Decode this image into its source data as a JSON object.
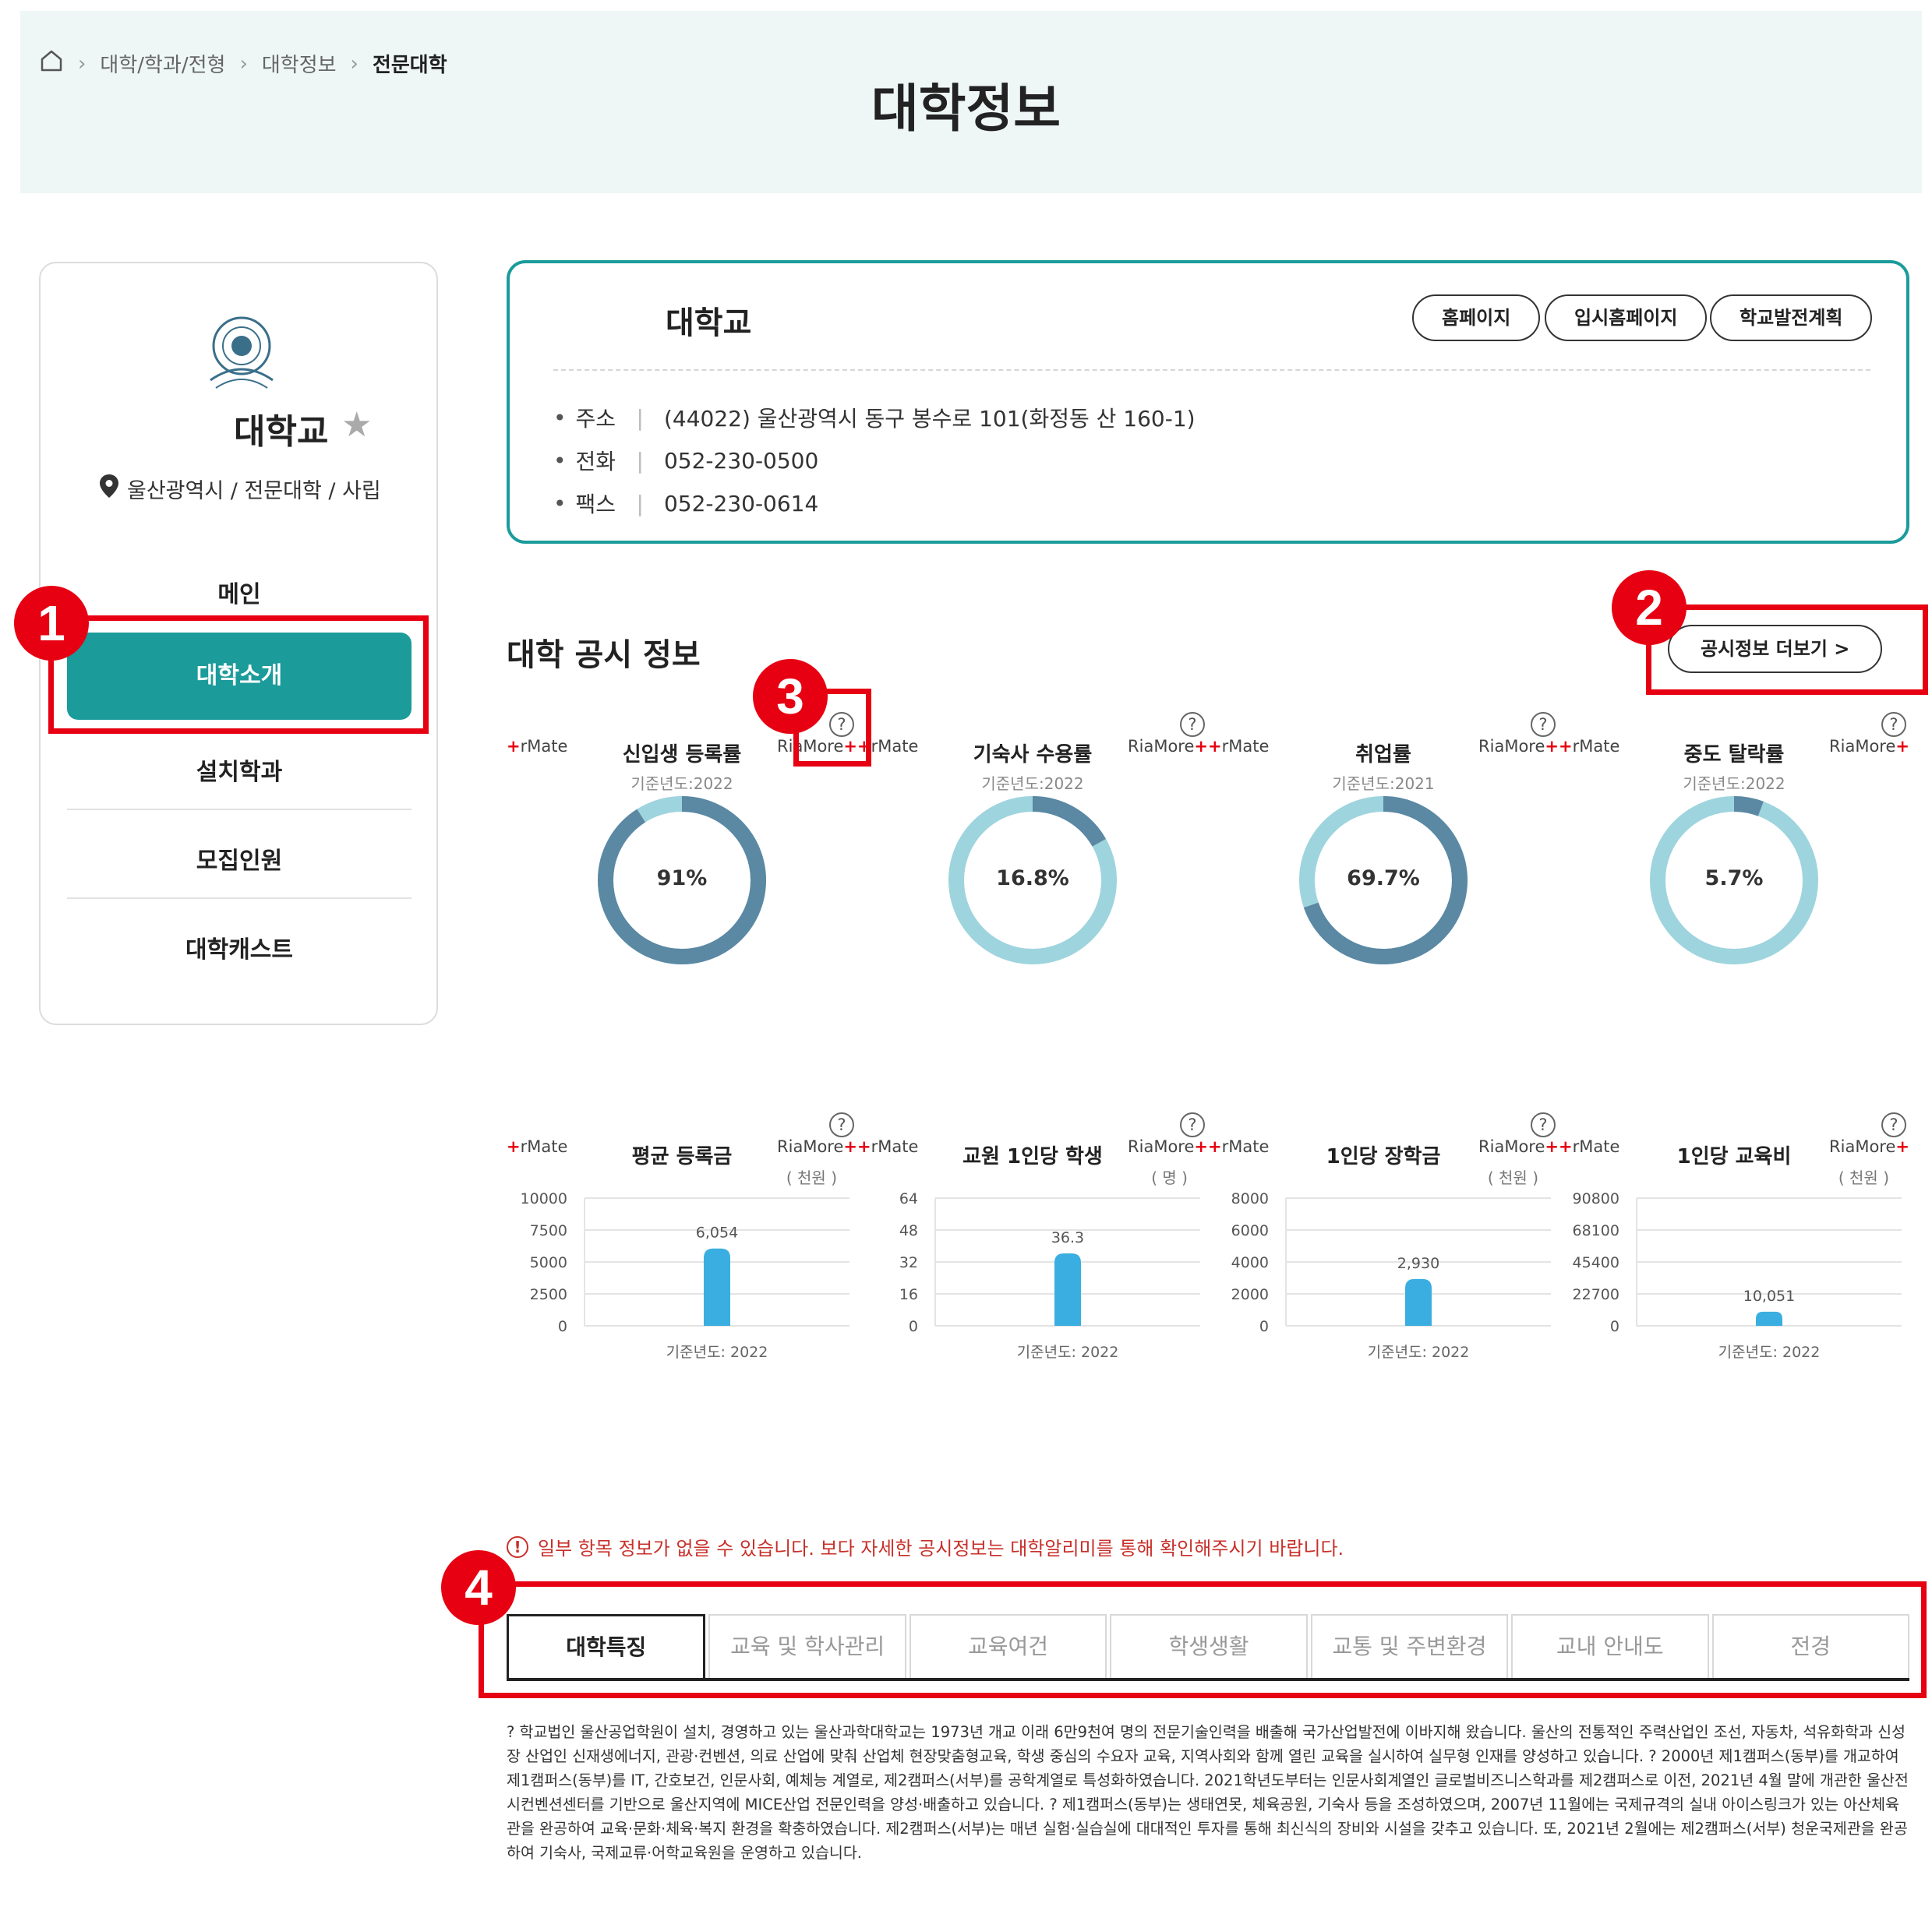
{
  "breadcrumb": {
    "home_icon": "home-icon",
    "items": [
      "대학/학과/전형",
      "대학정보",
      "전문대학"
    ]
  },
  "page_title": "대학정보",
  "sidebar": {
    "school_name": "대학교",
    "location": "울산광역시 / 전문대학 / 사립",
    "menu": [
      "메인",
      "대학소개",
      "설치학과",
      "모집인원",
      "대학캐스트"
    ],
    "active_menu": "대학소개"
  },
  "info_card": {
    "title": "대학교",
    "buttons": [
      "홈페이지",
      "입시홈페이지",
      "학교발전계획"
    ],
    "address_label": "주소",
    "address": "(44022) 울산광역시 동구 봉수로 101(화정동 산 160-1)",
    "tel_label": "전화",
    "tel": "052-230-0500",
    "fax_label": "팩스",
    "fax": "052-230-0614"
  },
  "disclosure": {
    "title": "대학 공시 정보",
    "more_button": "공시정보 더보기 >",
    "rmate_text": "rMate",
    "riamore_text": "RiaMore",
    "help_glyph": "?",
    "donuts": [
      {
        "label": "신입생 등록률",
        "base_year": "기준년도:2022",
        "value_text": "91%",
        "percent": 91
      },
      {
        "label": "기숙사 수용률",
        "base_year": "기준년도:2022",
        "value_text": "16.8%",
        "percent": 16.8
      },
      {
        "label": "취업률",
        "base_year": "기준년도:2021",
        "value_text": "69.7%",
        "percent": 69.7
      },
      {
        "label": "중도 탈락률",
        "base_year": "기준년도:2022",
        "value_text": "5.7%",
        "percent": 5.7
      }
    ],
    "bar_charts": [
      {
        "label": "평균 등록금",
        "unit": "( 천원 )",
        "value": 6054,
        "value_label": "6,054",
        "ymax": 10000,
        "ticks": [
          "10000",
          "7500",
          "5000",
          "2500",
          "0"
        ],
        "xlabel": "기준년도: 2022"
      },
      {
        "label": "교원 1인당 학생",
        "unit": "( 명 )",
        "value": 36.3,
        "value_label": "36.3",
        "ymax": 64,
        "ticks": [
          "64",
          "48",
          "32",
          "16",
          "0"
        ],
        "xlabel": "기준년도: 2022"
      },
      {
        "label": "1인당 장학금",
        "unit": "( 천원 )",
        "value": 2930,
        "value_label": "2,930",
        "ymax": 8000,
        "ticks": [
          "8000",
          "6000",
          "4000",
          "2000",
          "0"
        ],
        "xlabel": "기준년도: 2022"
      },
      {
        "label": "1인당 교육비",
        "unit": "( 천원 )",
        "value": 10051,
        "value_label": "10,051",
        "ymax": 90800,
        "ticks": [
          "90800",
          "68100",
          "45400",
          "22700",
          "0"
        ],
        "xlabel": "기준년도: 2022"
      }
    ],
    "colors": {
      "donut_track": "#9ed4de",
      "donut_fill": "#5b88a3",
      "bar": "#3aaee0"
    }
  },
  "notice": "일부 항목 정보가 없을 수 있습니다. 보다 자세한 공시정보는 대학알리미를 통해 확인해주시기 바랍니다.",
  "tabs": [
    "대학특징",
    "교육 및 학사관리",
    "교육여건",
    "학생생활",
    "교통 및 주변환경",
    "교내 안내도",
    "전경"
  ],
  "active_tab": "대학특징",
  "description": "? 학교법인 울산공업학원이 설치, 경영하고 있는 울산과학대학교는 1973년 개교 이래 6만9천여 명의 전문기술인력을 배출해 국가산업발전에 이바지해 왔습니다. 울산의 전통적인 주력산업인 조선, 자동차, 석유화학과 신성장 산업인 신재생에너지, 관광·컨벤션, 의료 산업에 맞춰 산업체 현장맞춤형교육, 학생 중심의 수요자 교육, 지역사회와 함께 열린 교육을 실시하여 실무형 인재를 양성하고 있습니다. ? 2000년 제1캠퍼스(동부)를 개교하여 제1캠퍼스(동부)를 IT, 간호보건, 인문사회, 예체능 계열로, 제2캠퍼스(서부)를 공학계열로 특성화하였습니다. 2021학년도부터는 인문사회계열인 글로벌비즈니스학과를 제2캠퍼스로 이전, 2021년 4월 말에 개관한 울산전시컨벤션센터를 기반으로 울산지역에 MICE산업 전문인력을 양성·배출하고 있습니다. ? 제1캠퍼스(동부)는 생태연못, 체육공원, 기숙사 등을 조성하였으며, 2007년 11월에는 국제규격의 실내 아이스링크가 있는 아산체육관을 완공하여 교육·문화·체육·복지 환경을 확충하였습니다. 제2캠퍼스(서부)는 매년 실험·실습실에 대대적인 투자를 통해 최신식의 장비와 시설을 갖추고 있습니다. 또, 2021년 2월에는 제2캠퍼스(서부) 청운국제관을 완공하여 기숙사, 국제교류·어학교육원을 운영하고 있습니다.",
  "annotations": [
    "1",
    "2",
    "3",
    "4"
  ],
  "annotation_color": "#e60012"
}
